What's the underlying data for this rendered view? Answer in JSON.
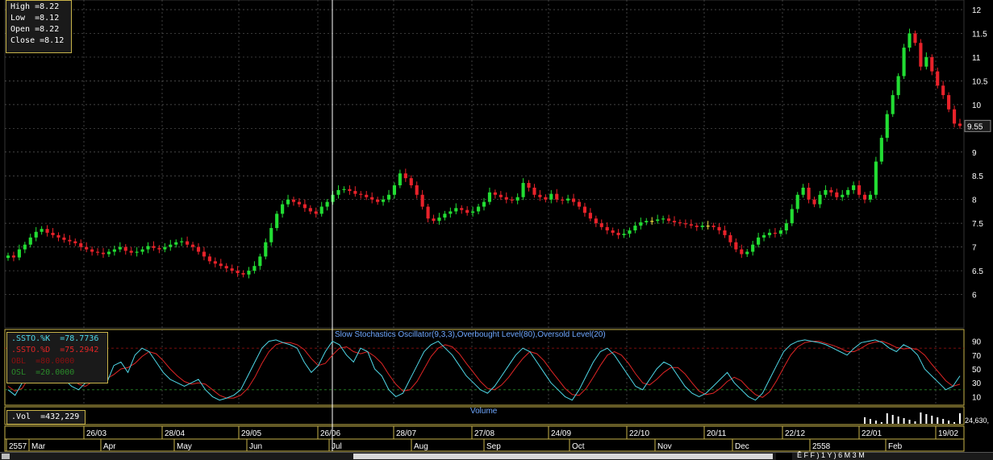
{
  "ohlc_box": {
    "high_label": "High",
    "high": "=8.22",
    "low_label": "Low",
    "low": "=8.12",
    "open_label": "Open",
    "open": "=8.22",
    "close_label": "Close",
    "close": "=8.12"
  },
  "current_price_label": "9.55",
  "stochastic": {
    "title": "Slow Stochastics Oscillator(9,3,3),Overbought Level(80),Oversold Level(20)",
    "k_label": ".SSTO.%K",
    "k_value": "=78.7736",
    "d_label": ".SSTO.%D",
    "d_value": "=75.2942",
    "obl_label": "OBL",
    "obl_value": "=80.0000",
    "osl_label": "OSL",
    "osl_value": "=20.0000",
    "y_ticks": [
      "90",
      "70",
      "50",
      "30",
      "10"
    ]
  },
  "volume": {
    "title": "Volume",
    "legend_label": ".Vol",
    "legend_value": "=432,229",
    "axis_label": "24,630,"
  },
  "dates_row": [
    "26/03",
    "28/04",
    "29/05",
    "26/06",
    "28/07",
    "27/08",
    "24/09",
    "22/10",
    "20/11",
    "22/12",
    "22/01",
    "19/02"
  ],
  "months_row": [
    "2557",
    "Mar",
    "Apr",
    "May",
    "Jun",
    "Jul",
    "Aug",
    "Sep",
    "Oct",
    "Nov",
    "Dec",
    "2558",
    "Feb"
  ],
  "toolbar_text": "Ē F F ) 1 Y ) 6 M 3 M",
  "colors": {
    "up": "#22dd33",
    "down": "#e8222a",
    "doji": "#f0e040",
    "k_line": "#4fd8e8",
    "d_line": "#e02525",
    "grid": "#5a5a5a",
    "frame": "#c9b44a",
    "cursor": "#ffffff"
  },
  "chart_data": {
    "type": "candlestick",
    "y_axis": {
      "min": 5.5,
      "max": 12.0,
      "ticks": [
        6,
        6.5,
        7,
        7.5,
        8,
        8.5,
        9,
        9.5,
        10,
        10.5,
        11,
        11.5,
        12
      ]
    },
    "close_series": [
      6.82,
      6.78,
      6.95,
      7.05,
      7.2,
      7.32,
      7.38,
      7.3,
      7.25,
      7.2,
      7.15,
      7.12,
      7.08,
      7.0,
      6.95,
      6.9,
      6.88,
      6.85,
      6.9,
      6.95,
      7.0,
      6.92,
      6.88,
      6.9,
      6.95,
      7.02,
      6.98,
      6.95,
      7.0,
      7.05,
      7.1,
      7.12,
      7.05,
      7.0,
      6.9,
      6.8,
      6.7,
      6.65,
      6.6,
      6.55,
      6.5,
      6.45,
      6.42,
      6.5,
      6.6,
      6.8,
      7.1,
      7.4,
      7.7,
      7.9,
      8.0,
      7.95,
      7.9,
      7.82,
      7.75,
      7.7,
      7.85,
      7.95,
      8.1,
      8.2,
      8.22,
      8.18,
      8.12,
      8.1,
      8.05,
      8.0,
      7.95,
      8.0,
      8.1,
      8.3,
      8.55,
      8.45,
      8.3,
      8.1,
      7.85,
      7.6,
      7.55,
      7.62,
      7.7,
      7.75,
      7.82,
      7.78,
      7.72,
      7.75,
      7.85,
      7.95,
      8.15,
      8.1,
      8.05,
      8.0,
      7.98,
      8.05,
      8.35,
      8.25,
      8.1,
      8.05,
      8.0,
      8.12,
      8.0,
      7.98,
      8.02,
      7.95,
      7.85,
      7.72,
      7.6,
      7.5,
      7.42,
      7.35,
      7.3,
      7.25,
      7.28,
      7.35,
      7.45,
      7.52,
      7.55,
      7.55,
      7.58,
      7.6,
      7.55,
      7.52,
      7.5,
      7.48,
      7.45,
      7.42,
      7.45,
      7.45,
      7.42,
      7.35,
      7.25,
      7.1,
      6.95,
      6.85,
      6.9,
      7.05,
      7.2,
      7.25,
      7.3,
      7.28,
      7.35,
      7.5,
      7.8,
      8.1,
      8.25,
      8.0,
      7.9,
      8.1,
      8.2,
      8.15,
      8.05,
      8.1,
      8.2,
      8.3,
      8.1,
      8.0,
      8.1,
      8.8,
      9.3,
      9.8,
      10.2,
      10.6,
      11.2,
      11.5,
      11.3,
      10.8,
      11.0,
      10.7,
      10.4,
      10.2,
      9.9,
      9.6,
      9.55
    ],
    "stoch_k": [
      20,
      12,
      30,
      55,
      80,
      90,
      75,
      50,
      35,
      25,
      20,
      30,
      45,
      40,
      30,
      55,
      60,
      45,
      70,
      80,
      75,
      60,
      45,
      35,
      30,
      25,
      30,
      35,
      20,
      10,
      5,
      8,
      12,
      20,
      40,
      60,
      80,
      90,
      92,
      88,
      85,
      80,
      60,
      45,
      55,
      75,
      90,
      85,
      70,
      60,
      80,
      75,
      50,
      40,
      20,
      10,
      15,
      35,
      55,
      75,
      85,
      90,
      80,
      70,
      55,
      40,
      30,
      20,
      15,
      25,
      40,
      55,
      70,
      80,
      75,
      60,
      45,
      30,
      20,
      10,
      5,
      20,
      40,
      60,
      75,
      80,
      70,
      55,
      40,
      25,
      20,
      35,
      50,
      60,
      55,
      40,
      25,
      15,
      10,
      15,
      25,
      35,
      45,
      30,
      20,
      10,
      5,
      15,
      35,
      55,
      75,
      85,
      90,
      92,
      90,
      88,
      85,
      80,
      75,
      70,
      80,
      88,
      90,
      92,
      88,
      80,
      75,
      85,
      80,
      70,
      50,
      40,
      30,
      20,
      25,
      40
    ],
    "stoch_d": [
      25,
      18,
      22,
      38,
      60,
      78,
      80,
      68,
      52,
      38,
      28,
      25,
      32,
      38,
      36,
      42,
      50,
      52,
      58,
      68,
      75,
      72,
      62,
      50,
      40,
      32,
      28,
      30,
      28,
      20,
      12,
      8,
      8,
      12,
      22,
      38,
      58,
      75,
      85,
      88,
      88,
      85,
      78,
      65,
      55,
      58,
      70,
      80,
      82,
      75,
      72,
      75,
      68,
      58,
      42,
      28,
      18,
      20,
      32,
      50,
      68,
      80,
      85,
      82,
      72,
      58,
      45,
      32,
      22,
      20,
      27,
      38,
      52,
      65,
      75,
      72,
      62,
      48,
      35,
      22,
      13,
      12,
      22,
      38,
      55,
      70,
      75,
      70,
      58,
      43,
      30,
      27,
      35,
      45,
      52,
      52,
      43,
      30,
      18,
      13,
      15,
      22,
      32,
      38,
      33,
      22,
      13,
      9,
      17,
      33,
      52,
      70,
      82,
      88,
      90,
      90,
      87,
      84,
      80,
      75,
      75,
      80,
      86,
      89,
      90,
      86,
      81,
      79,
      80,
      78,
      70,
      57,
      45,
      33,
      25,
      28
    ]
  }
}
